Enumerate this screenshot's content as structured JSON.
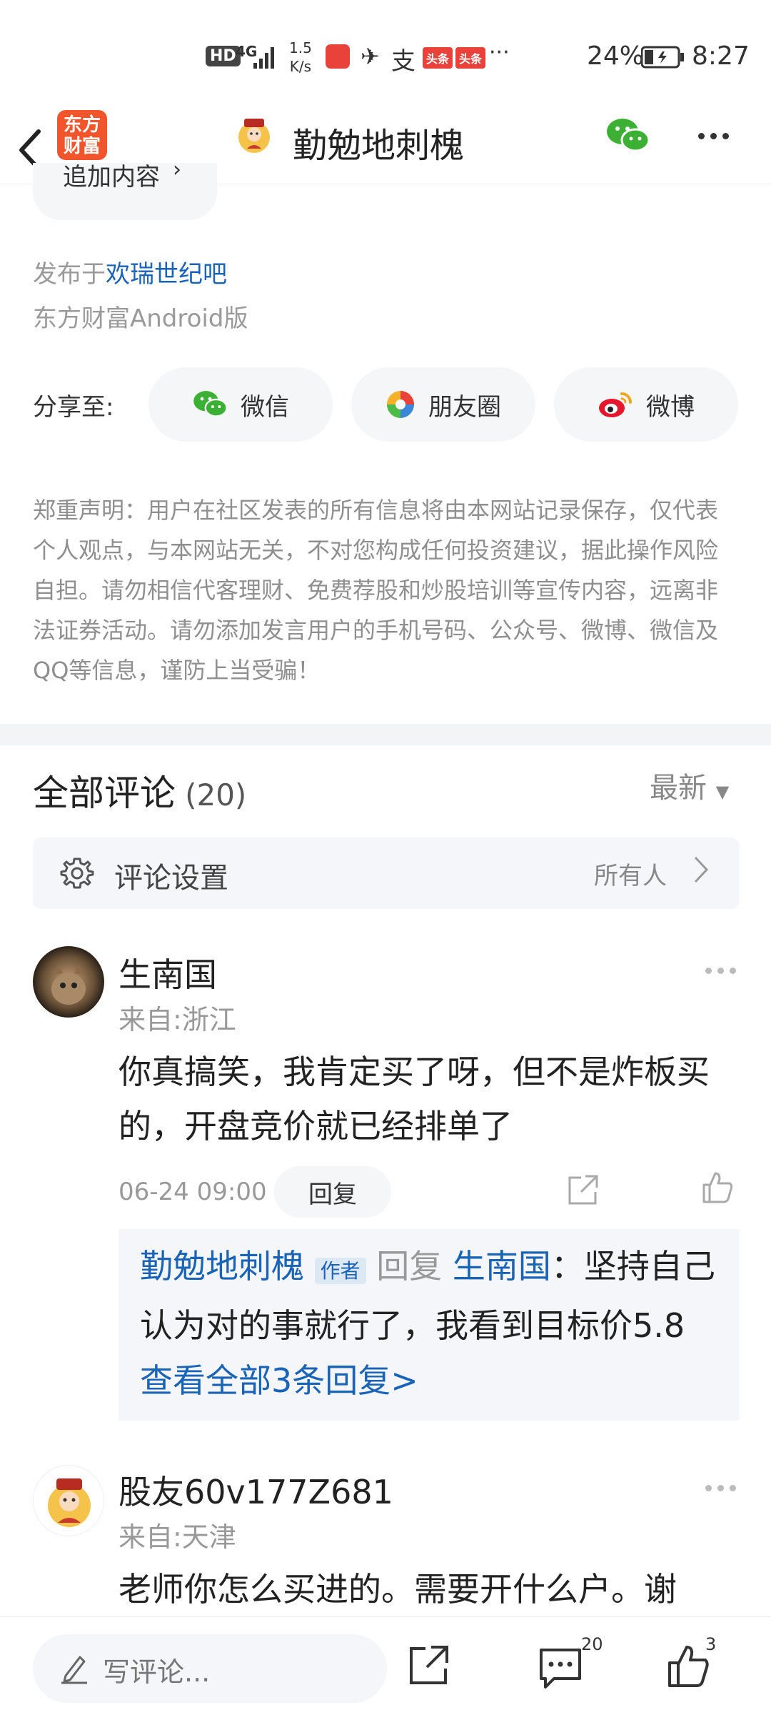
{
  "status": {
    "hd": "HD",
    "net": "4G",
    "speed_top": "1.5",
    "speed_bottom": "K/s",
    "badge1": "头条",
    "badge2": "头条",
    "more": "···",
    "battery": "24%",
    "time": "8:27"
  },
  "nav": {
    "logo_line1": "东方",
    "logo_line2": "财富",
    "title": "勤勉地刺槐"
  },
  "post": {
    "append_label": "追加内容",
    "published_prefix": "发布于",
    "published_bar": "欢瑞世纪吧",
    "client": "东方财富Android版",
    "share_label": "分享至:",
    "share_wechat": "微信",
    "share_moments": "朋友圈",
    "share_weibo": "微博",
    "disclaimer": "郑重声明：用户在社区发表的所有信息将由本网站记录保存，仅代表个人观点，与本网站无关，不对您构成任何投资建议，据此操作风险自担。请勿相信代客理财、免费荐股和炒股培训等宣传内容，远离非法证券活动。请勿添加发言用户的手机号码、公众号、微博、微信及QQ等信息，谨防上当受骗！"
  },
  "comments_header": {
    "title": "全部评论",
    "count": "(20)",
    "sort": "最新",
    "settings_label": "评论设置",
    "settings_value": "所有人"
  },
  "comments": [
    {
      "name": "生南国",
      "from": "来自:浙江",
      "content": "你真搞笑，我肯定买了呀，但不是炸板买的，开盘竞价就已经排单了",
      "time": "06-24 09:00",
      "reply_btn": "回复",
      "reply": {
        "author": "勤勉地刺槐",
        "author_tag": "作者",
        "verb": "回复",
        "target": "生南国",
        "text": "：坚持自己认为对的事就行了，我看到目标价5.8",
        "view_all": "查看全部3条回复>"
      }
    },
    {
      "name": "股友60v177Z681",
      "from": "来自:天津",
      "content": "老师你怎么买进的。需要开什么户。谢"
    }
  ],
  "bottom": {
    "placeholder": "写评论...",
    "comment_count": "20",
    "like_count": "3"
  }
}
